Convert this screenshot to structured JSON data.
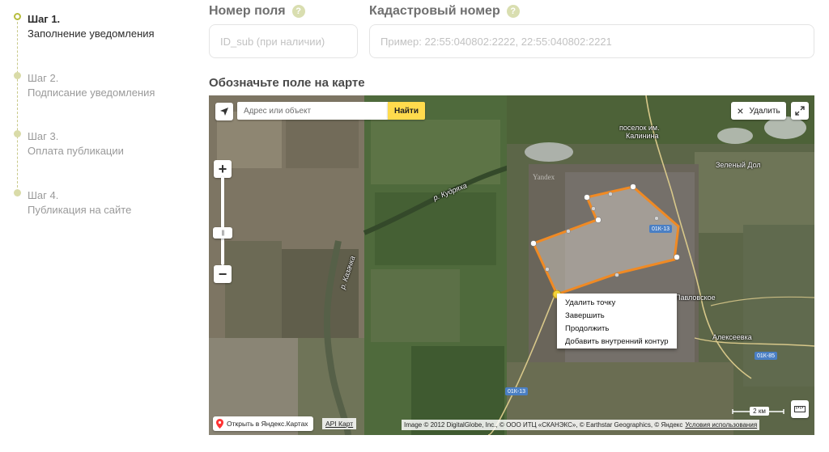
{
  "steps": [
    {
      "title": "Шаг 1.",
      "description": "Заполнение уведомления",
      "active": true
    },
    {
      "title": "Шаг 2.",
      "description": "Подписание уведомления",
      "active": false
    },
    {
      "title": "Шаг 3.",
      "description": "Оплата публикации",
      "active": false
    },
    {
      "title": "Шаг 4.",
      "description": "Публикация на сайте",
      "active": false
    }
  ],
  "fields": {
    "field_number": {
      "label": "Номер поля",
      "placeholder": "ID_sub (при наличии)",
      "value": ""
    },
    "cadastral_number": {
      "label": "Кадастровый номер",
      "placeholder": "Пример: 22:55:040802:2222, 22:55:040802:2221",
      "value": ""
    }
  },
  "map_section": {
    "title": "Обозначьте поле на карте"
  },
  "map": {
    "search_placeholder": "Адрес или объект",
    "search_button": "Найти",
    "delete_button": "Удалить",
    "context_menu": [
      "Удалить точку",
      "Завершить",
      "Продолжить",
      "Добавить внутренний контур"
    ],
    "place_labels": {
      "kalinina_1": "поселок им.",
      "kalinina_2": "Калинина",
      "zeleny_dol": "Зеленый Дол",
      "pavlovskoe": "Павловское",
      "alekseevka": "Алексеевка",
      "kudryakh": "р. Кудряха",
      "kazachka": "р. Казачка"
    },
    "road_labels": {
      "r1": "01К-13",
      "r2": "01К-85",
      "r3": "01К-13"
    },
    "watermark": "Yandex",
    "scale": "2 км",
    "open_in_maps": "Открыть в Яндекс.Картах",
    "api_link": "API Карт",
    "copyright": "Image © 2012 DigitalGlobe, Inc., © ООО ИТЦ «СКАНЭКС», © Earthstar Geographics, © Яндекс",
    "terms": "Условия использования"
  },
  "colors": {
    "accent_yellow": "#ffdb4d",
    "polygon_stroke": "#f08a24",
    "step_active_dot": "#b7bd3d",
    "help_icon": "#d9deb0"
  },
  "icons": {
    "help": "?",
    "geolocation": "navigation-arrow-icon",
    "close": "×",
    "zoom_in": "+",
    "zoom_out": "−"
  }
}
